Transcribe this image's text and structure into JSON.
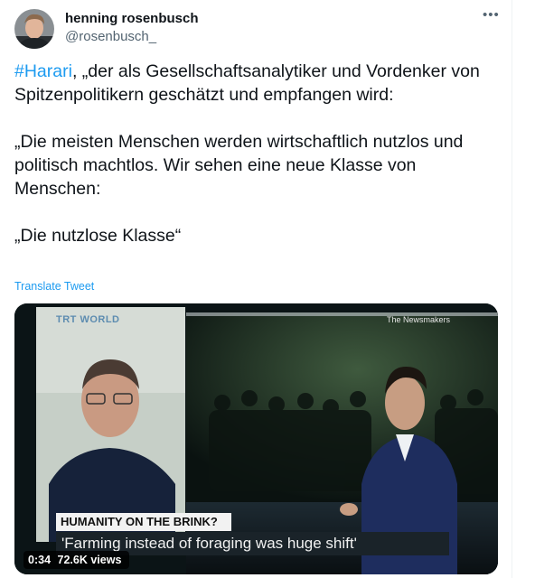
{
  "tweet": {
    "author_name": "henning rosenbusch",
    "author_handle": "@rosenbusch_",
    "more_icon": "more-icon",
    "hashtag": "#Harari",
    "p1_rest": ", „der als Gesellschaftsanalytiker und Vordenker von Spitzenpolitikern geschätzt und empfangen wird:",
    "p2": "„Die meisten Menschen werden wirtschaftlich nutzlos und politisch machtlos. Wir sehen eine neue Klasse von Menschen:",
    "p3": "„Die nutzlose Klasse“",
    "translate_link": "Translate Tweet"
  },
  "video": {
    "channel_logo": "TRT WORLD",
    "show_name": "The Newsmakers",
    "banner_top": "HUMANITY ON THE BRINK?",
    "banner_quote": "'Farming instead of foraging was huge shift'",
    "duration": "0:34",
    "views": "72.6K views"
  },
  "colors": {
    "accent": "#1d9bf0",
    "text_primary": "#0f1419",
    "text_secondary": "#536471"
  }
}
